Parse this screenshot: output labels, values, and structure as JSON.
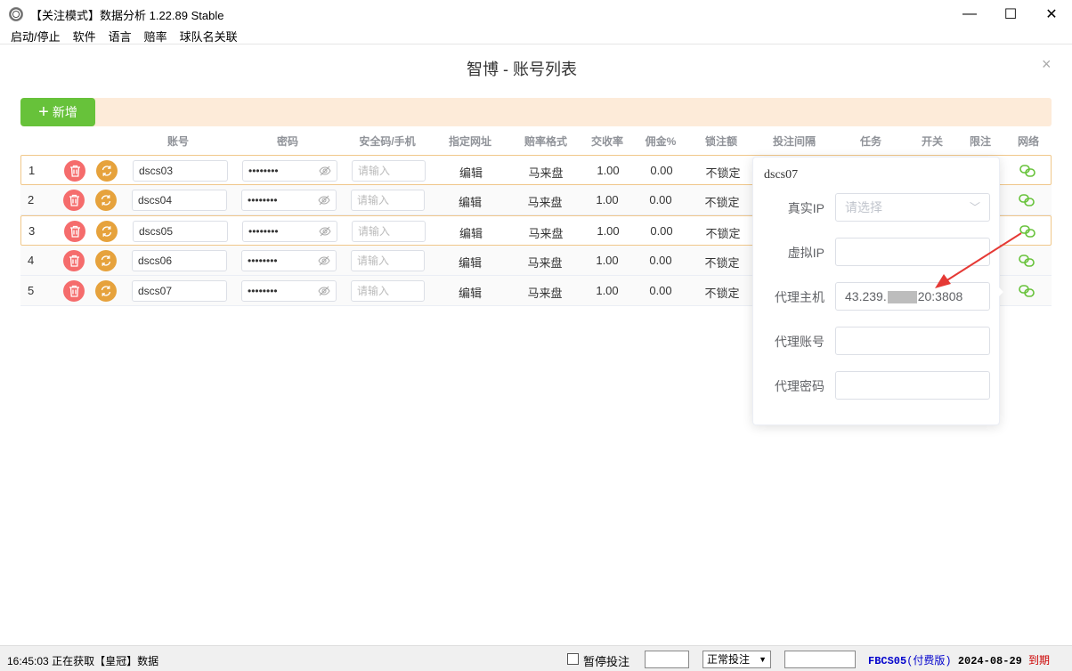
{
  "window": {
    "title": "【关注模式】数据分析 1.22.89 Stable",
    "minimize": "—",
    "maximize": "☐",
    "close": "✕"
  },
  "menu": [
    "启动/停止",
    "软件",
    "语言",
    "赔率",
    "球队名关联"
  ],
  "dialog": {
    "title": "智博 - 账号列表",
    "close": "×",
    "add_label": "新增"
  },
  "table": {
    "columns": [
      "账号",
      "密码",
      "安全码/手机",
      "指定网址",
      "赔率格式",
      "交收率",
      "佣金%",
      "锁注额",
      "投注间隔",
      "任务",
      "开关",
      "限注",
      "网络"
    ],
    "rows": [
      {
        "num": "1",
        "account": "dscs03",
        "password": "••••••••",
        "security_placeholder": "请输入",
        "url": "编辑",
        "odds_format": "马来盘",
        "rate": "1.00",
        "commission": "0.00",
        "lock": "不锁定"
      },
      {
        "num": "2",
        "account": "dscs04",
        "password": "••••••••",
        "security_placeholder": "请输入",
        "url": "编辑",
        "odds_format": "马来盘",
        "rate": "1.00",
        "commission": "0.00",
        "lock": "不锁定"
      },
      {
        "num": "3",
        "account": "dscs05",
        "password": "••••••••",
        "security_placeholder": "请输入",
        "url": "编辑",
        "odds_format": "马来盘",
        "rate": "1.00",
        "commission": "0.00",
        "lock": "不锁定"
      },
      {
        "num": "4",
        "account": "dscs06",
        "password": "••••••••",
        "security_placeholder": "请输入",
        "url": "编辑",
        "odds_format": "马来盘",
        "rate": "1.00",
        "commission": "0.00",
        "lock": "不锁定"
      },
      {
        "num": "5",
        "account": "dscs07",
        "password": "••••••••",
        "security_placeholder": "请输入",
        "url": "编辑",
        "odds_format": "马来盘",
        "rate": "1.00",
        "commission": "0.00",
        "lock": "不锁定"
      }
    ]
  },
  "popover": {
    "title": "dscs07",
    "real_ip_label": "真实IP",
    "real_ip_placeholder": "请选择",
    "virtual_ip_label": "虚拟IP",
    "proxy_host_label": "代理主机",
    "proxy_host_prefix": "43.239.",
    "proxy_host_suffix": "20:3808",
    "proxy_account_label": "代理账号",
    "proxy_password_label": "代理密码"
  },
  "status": {
    "time": "16:45:03",
    "message": "正在获取【皇冠】数据",
    "pause_label": "暂停投注",
    "mode_value": "正常投注",
    "license_code": "FBCS05",
    "license_type": "(付费版)",
    "license_date": "2024-08-29",
    "license_expire": "到期"
  },
  "colors": {
    "add_button": "#67c23a",
    "delete_button": "#f56c6c",
    "refresh_button": "#e6a23c",
    "network_icon": "#67c23a",
    "annotation_arrow": "#e53935"
  },
  "icons": {
    "delete": "trash-icon",
    "refresh": "refresh-icon",
    "password_toggle": "eye-off-icon",
    "network": "link-icon",
    "select": "chevron-down-icon"
  }
}
